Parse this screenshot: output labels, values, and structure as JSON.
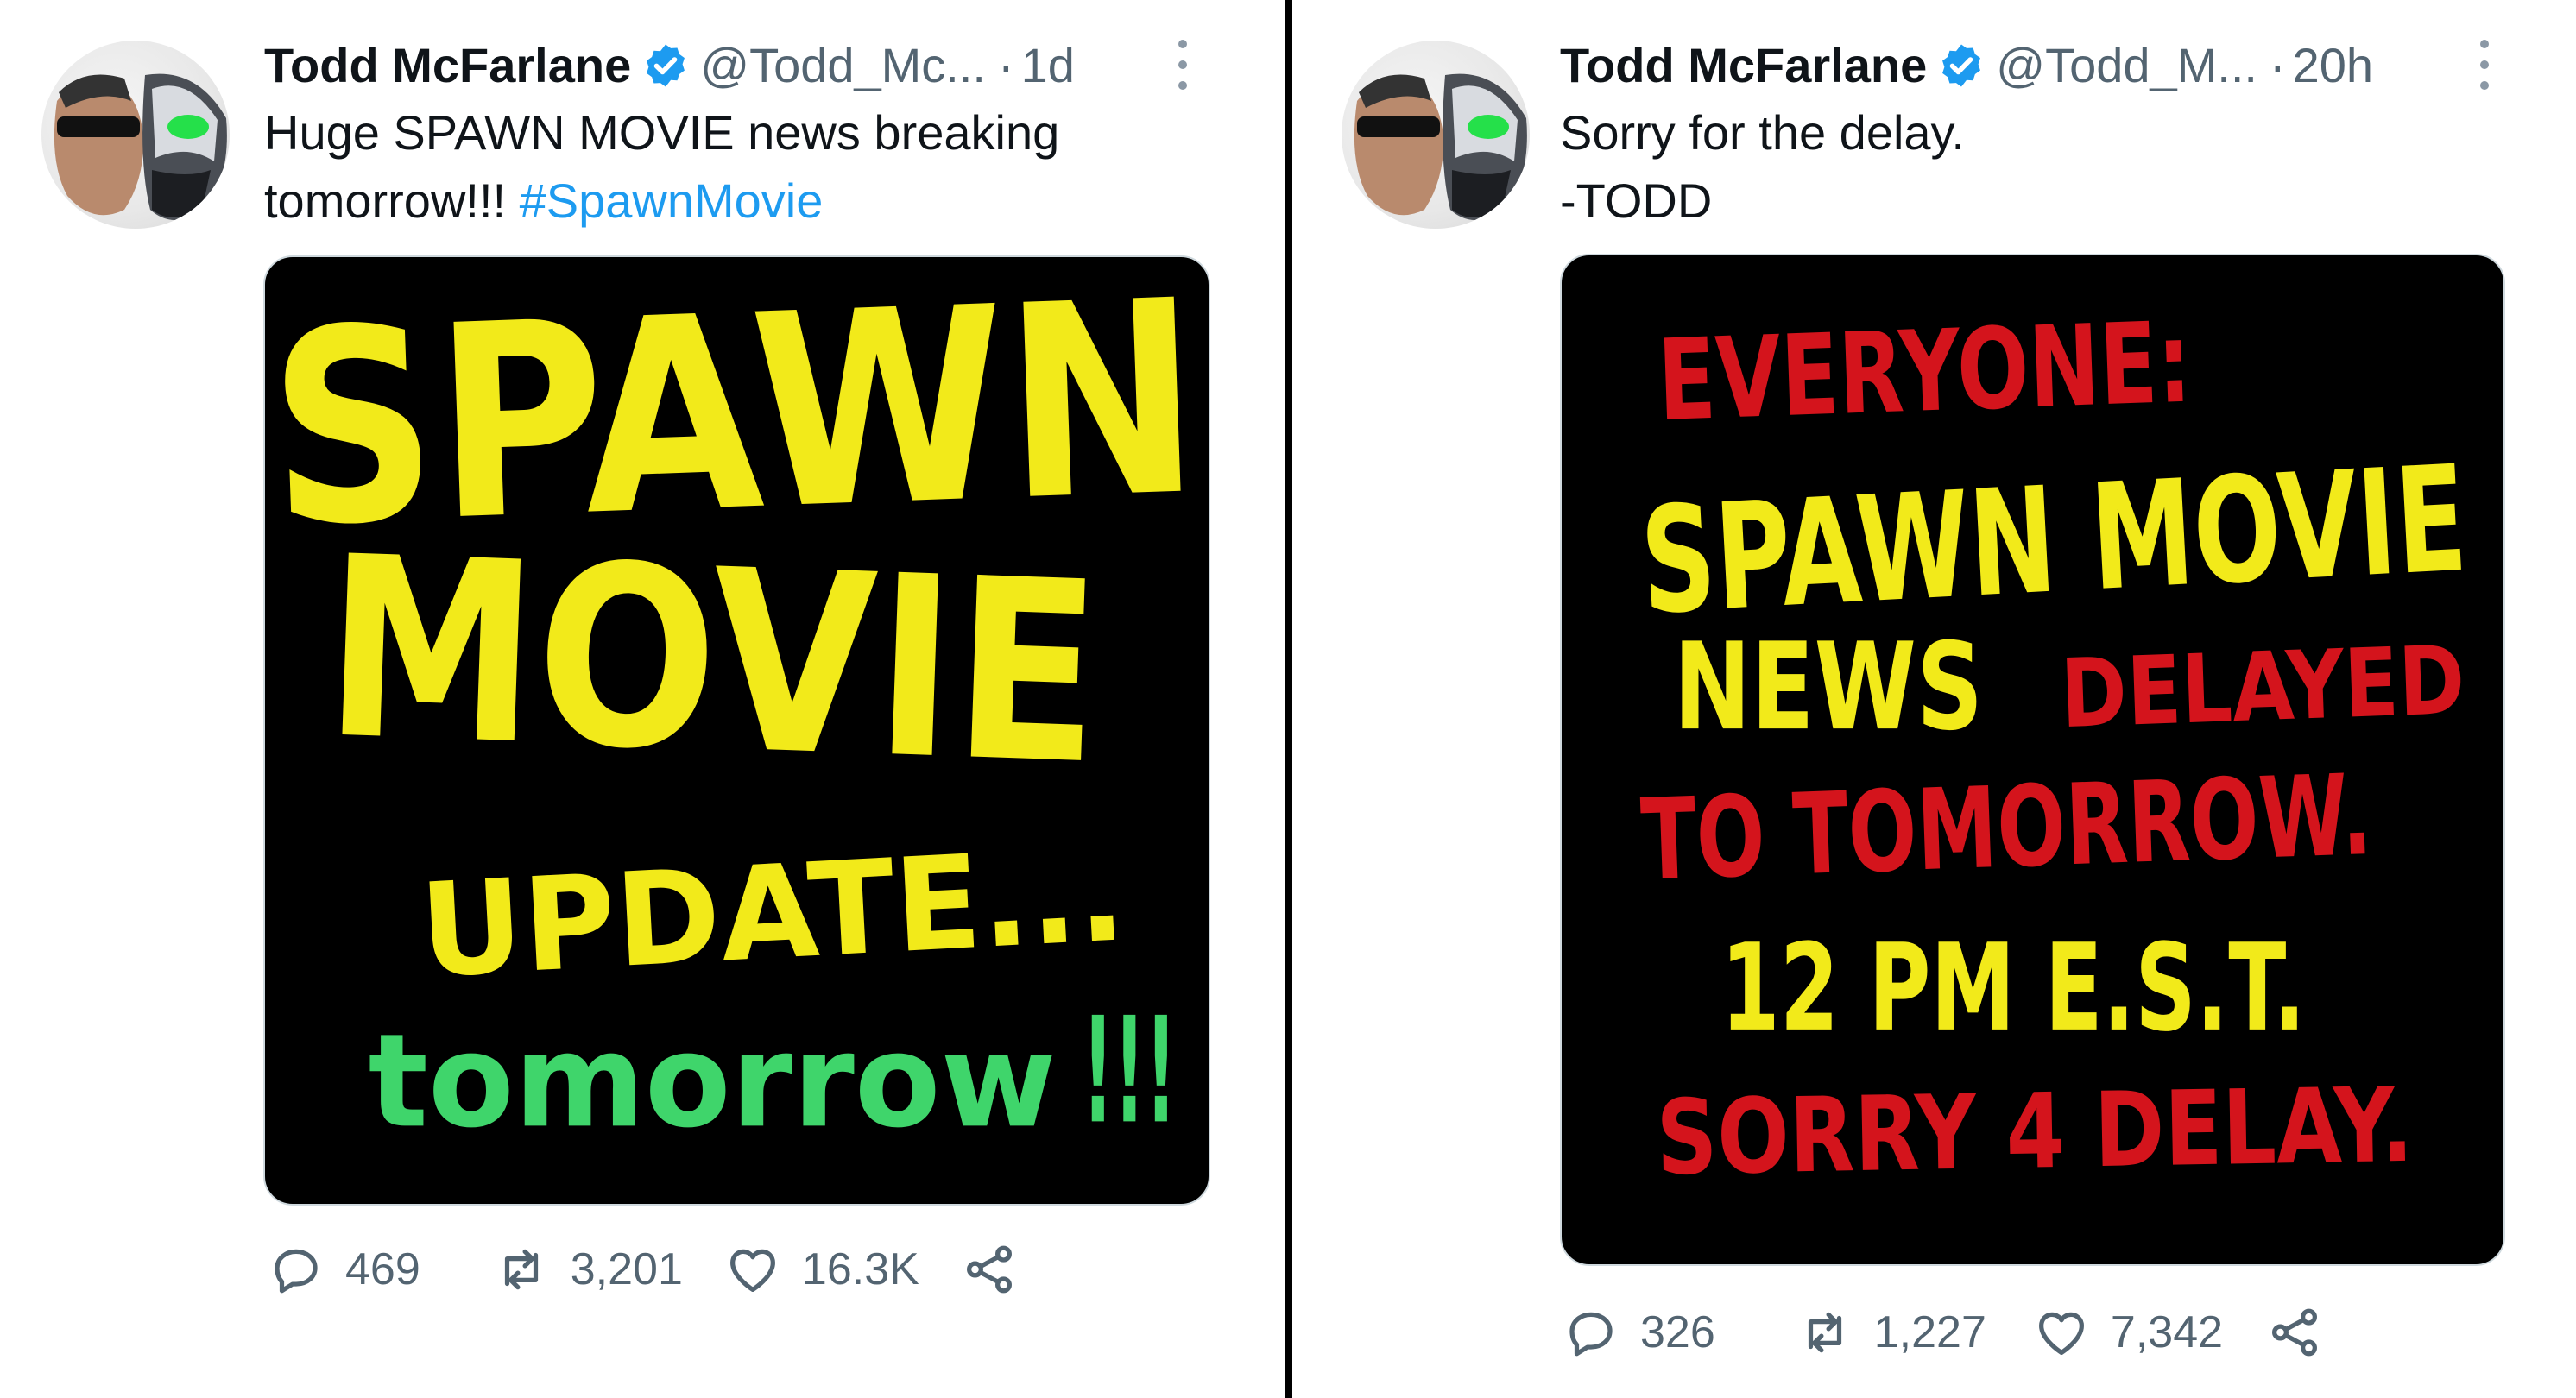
{
  "tweets": [
    {
      "author": {
        "display_name": "Todd McFarlane",
        "handle": "@Todd_Mc...",
        "time": "1d"
      },
      "text_line1": "Huge SPAWN MOVIE news breaking",
      "text_line2": "tomorrow!!!",
      "hashtag": "#SpawnMovie",
      "image_text": {
        "line1": "SPAWN",
        "line2": "MOVIE",
        "line3": "UPDATE...",
        "line4": "tomorrow",
        "line4_end": "!!!"
      },
      "stats": {
        "replies": "469",
        "retweets": "3,201",
        "likes": "16.3K"
      }
    },
    {
      "author": {
        "display_name": "Todd McFarlane",
        "handle": "@Todd_M...",
        "time": "20h"
      },
      "text_line1": "Sorry for the delay.",
      "text_line2": "-TODD",
      "image_text": {
        "line1": "EVERYONE:",
        "line2": "SPAWN MOVIE",
        "line3a": "NEWS",
        "line3b": "DELAYED",
        "line4": "TO TOMORROW.",
        "line5": "12 PM E.S.T.",
        "line6": "SORRY 4 DELAY."
      },
      "stats": {
        "replies": "326",
        "retweets": "1,227",
        "likes": "7,342"
      }
    }
  ],
  "colors": {
    "name": "#0f1419",
    "secondary": "#536471",
    "link": "#1d9bf0",
    "verified": "#1d9bf0",
    "hand_yellow": "#f2ea1a",
    "hand_green": "#3fd56b",
    "hand_red": "#d4141c"
  },
  "icons": [
    "verified-badge-icon",
    "more-icon",
    "reply-icon",
    "retweet-icon",
    "like-icon",
    "share-icon"
  ]
}
